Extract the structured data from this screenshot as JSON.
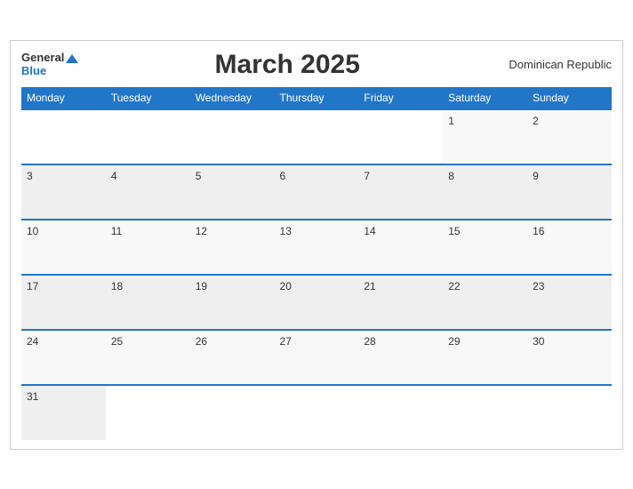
{
  "header": {
    "logo_general": "General",
    "logo_blue": "Blue",
    "title": "March 2025",
    "country": "Dominican Republic"
  },
  "weekdays": [
    "Monday",
    "Tuesday",
    "Wednesday",
    "Thursday",
    "Friday",
    "Saturday",
    "Sunday"
  ],
  "weeks": [
    [
      null,
      null,
      null,
      null,
      null,
      "1",
      "2"
    ],
    [
      "3",
      "4",
      "5",
      "6",
      "7",
      "8",
      "9"
    ],
    [
      "10",
      "11",
      "12",
      "13",
      "14",
      "15",
      "16"
    ],
    [
      "17",
      "18",
      "19",
      "20",
      "21",
      "22",
      "23"
    ],
    [
      "24",
      "25",
      "26",
      "27",
      "28",
      "29",
      "30"
    ],
    [
      "31",
      null,
      null,
      null,
      null,
      null,
      null
    ]
  ]
}
